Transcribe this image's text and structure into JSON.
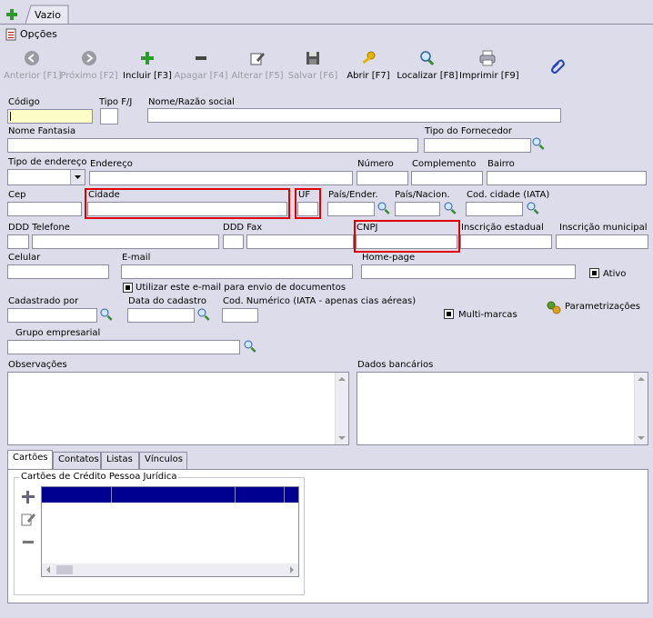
{
  "top": {
    "tab_label": "Vazio",
    "options_label": "Opções"
  },
  "toolbar": {
    "anterior": "Anterior [F1]",
    "proximo": "Próximo [F2]",
    "incluir": "Incluir [F3]",
    "apagar": "Apagar [F4]",
    "alterar": "Alterar [F5]",
    "salvar": "Salvar [F6]",
    "abrir": "Abrir [F7]",
    "localizar": "Localizar [F8]",
    "imprimir": "Imprimir [F9]"
  },
  "form": {
    "codigo": "Código",
    "tipo_fj": "Tipo F/J",
    "nome_razao": "Nome/Razão social",
    "nome_fantasia": "Nome Fantasia",
    "tipo_fornecedor": "Tipo do Fornecedor",
    "tipo_endereco": "Tipo de endereço",
    "endereco": "Endereço",
    "numero": "Número",
    "complemento": "Complemento",
    "bairro": "Bairro",
    "cep": "Cep",
    "cidade": "Cidade",
    "uf": "UF",
    "pais_ender": "País/Ender.",
    "pais_nacion": "País/Nacion.",
    "cod_cidade": "Cod. cidade (IATA)",
    "ddd_telefone": "DDD Telefone",
    "ddd_fax": "DDD Fax",
    "cnpj": "CNPJ",
    "inscricao_estadual": "Inscrição estadual",
    "inscricao_municipal": "Inscrição municipal",
    "celular": "Celular",
    "email": "E-mail",
    "home_page": "Home-page",
    "ativo": "Ativo",
    "utilizar_email": "Utilizar este e-mail para envio de documentos",
    "cadastrado_por": "Cadastrado por",
    "data_cadastro": "Data do cadastro",
    "cod_numerico": "Cod. Numérico (IATA - apenas cias aéreas)",
    "multi_marcas": "Multi-marcas",
    "parametrizacoes": "Parametrizações",
    "grupo_empresarial": "Grupo empresarial",
    "observacoes": "Observações",
    "dados_bancarios": "Dados bancários"
  },
  "bottom_tabs": [
    "Cartões",
    "Contatos",
    "Listas",
    "Vínculos"
  ],
  "cards_group": {
    "title": "Cartões de Crédito Pessoa Jurídica"
  }
}
